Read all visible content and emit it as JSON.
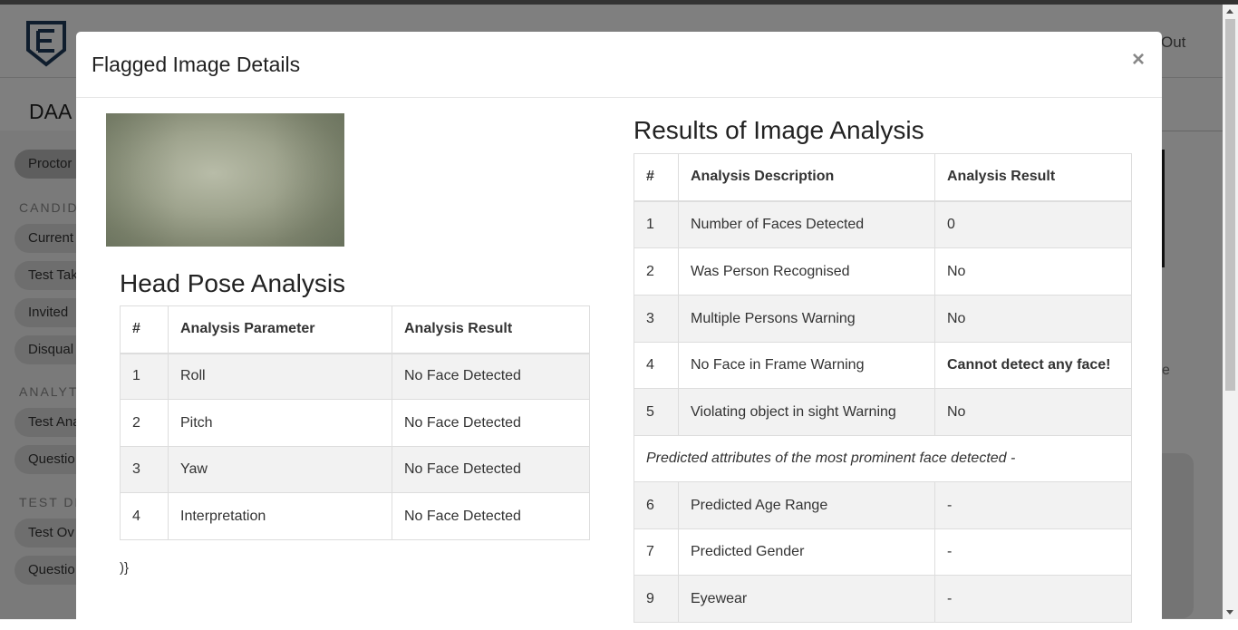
{
  "background": {
    "logout_label": "Out",
    "page_title": "DAA C",
    "sidebar": {
      "items": [
        {
          "label": "Proctor",
          "active": true
        },
        {
          "label": "Current"
        },
        {
          "label": "Test Tak"
        },
        {
          "label": "Invited"
        },
        {
          "label": "Disqual"
        },
        {
          "label": "Test Ana"
        },
        {
          "label": "Questio"
        },
        {
          "label": "Test Ov"
        },
        {
          "label": "Questio"
        }
      ],
      "sections": [
        "CANDID",
        "ANALYT",
        "TEST DE"
      ]
    },
    "right_text": "e"
  },
  "modal": {
    "title": "Flagged Image Details",
    "close_label": "×",
    "image_alt": "Flagged webcam image",
    "head_pose": {
      "title": "Head Pose Analysis",
      "columns": [
        "#",
        "Analysis Parameter",
        "Analysis Result"
      ],
      "rows": [
        {
          "num": "1",
          "param": "Roll",
          "result": "No Face Detected"
        },
        {
          "num": "2",
          "param": "Pitch",
          "result": "No Face Detected"
        },
        {
          "num": "3",
          "param": "Yaw",
          "result": "No Face Detected"
        },
        {
          "num": "4",
          "param": "Interpretation",
          "result": "No Face Detected"
        }
      ]
    },
    "stray_text": ")}",
    "image_analysis": {
      "title": "Results of Image Analysis",
      "columns": [
        "#",
        "Analysis Description",
        "Analysis Result"
      ],
      "rows": [
        {
          "num": "1",
          "desc": "Number of Faces Detected",
          "result": "0"
        },
        {
          "num": "2",
          "desc": "Was Person Recognised",
          "result": "No"
        },
        {
          "num": "3",
          "desc": "Multiple Persons Warning",
          "result": "No"
        },
        {
          "num": "4",
          "desc": "No Face in Frame Warning",
          "result": "Cannot detect any face!"
        },
        {
          "num": "5",
          "desc": "Violating object in sight Warning",
          "result": "No"
        }
      ],
      "note": "Predicted attributes of the most prominent face detected -",
      "predicted_rows": [
        {
          "num": "6",
          "desc": "Predicted Age Range",
          "result": "-"
        },
        {
          "num": "7",
          "desc": "Predicted Gender",
          "result": "-"
        },
        {
          "num": "9",
          "desc": "Eyewear",
          "result": "-"
        }
      ]
    }
  },
  "colors": {
    "overlay": "#000000",
    "modal_bg": "#ffffff",
    "stripe": "#f2f2f2",
    "border": "#dddddd"
  }
}
